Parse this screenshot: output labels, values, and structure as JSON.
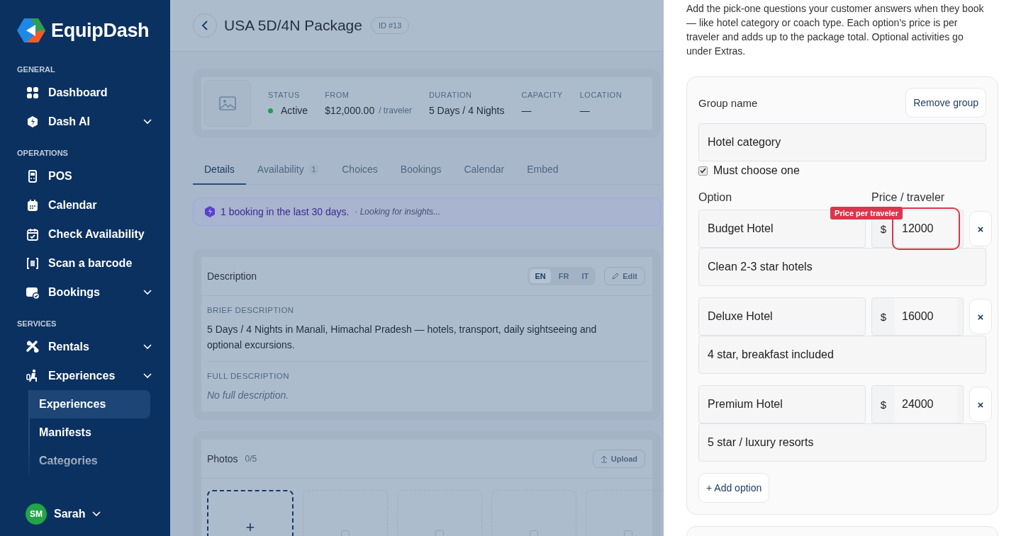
{
  "sidebar": {
    "logo": "EquipDash",
    "sections": [
      {
        "title": "GENERAL",
        "items": [
          {
            "label": "Dashboard",
            "has_menu": false
          },
          {
            "label": "Dash AI",
            "has_menu": true
          }
        ]
      },
      {
        "title": "OPERATIONS",
        "items": [
          {
            "label": "POS",
            "has_menu": false
          },
          {
            "label": "Calendar",
            "has_menu": false
          },
          {
            "label": "Check Availability",
            "has_menu": false
          },
          {
            "label": "Scan a barcode",
            "has_menu": false
          },
          {
            "label": "Bookings",
            "has_menu": true
          }
        ]
      },
      {
        "title": "SERVICES",
        "items": [
          {
            "label": "Rentals",
            "has_menu": true
          },
          {
            "label": "Experiences",
            "has_menu": true,
            "children": [
              {
                "label": "Experiences",
                "selected": true
              },
              {
                "label": "Manifests",
                "selected": false
              },
              {
                "label": "Categories",
                "selected": false
              }
            ]
          }
        ]
      }
    ],
    "user": {
      "initials": "SM",
      "name": "Sarah"
    }
  },
  "header": {
    "title": "USA 5D/4N Package",
    "id_badge": "ID #13"
  },
  "summary": [
    {
      "label": "STATUS",
      "value": "Active",
      "color": "#1f9d55"
    },
    {
      "label": "FROM",
      "value": "$12,000.00",
      "suffix": "/ traveler"
    },
    {
      "label": "DURATION",
      "value": "5 Days / 4 Nights"
    },
    {
      "label": "CAPACITY",
      "value": "—"
    },
    {
      "label": "LOCATION",
      "value": "—"
    }
  ],
  "tabs": [
    {
      "label": "Details",
      "selected": true
    },
    {
      "label": "Availability",
      "count": "1",
      "selected": false
    },
    {
      "label": "Choices",
      "selected": false
    },
    {
      "label": "Bookings",
      "selected": false
    },
    {
      "label": "Calendar",
      "selected": false
    },
    {
      "label": "Embed",
      "selected": false
    }
  ],
  "insight": {
    "text": "1 booking in the last 30 days.",
    "note": "· *Looking for insights...*"
  },
  "description": {
    "title": "Description",
    "languages": [
      {
        "label": "EN",
        "selected": true
      },
      {
        "label": "FR",
        "selected": false
      },
      {
        "label": "IT",
        "selected": false
      }
    ],
    "edit": "Edit",
    "sections": [
      {
        "label": "BRIEF DESCRIPTION",
        "text": "5 Days / 4 Nights in Manali, Himachal Pradesh — hotels, transport, daily sightseeing and optional excursions.",
        "empty": false
      },
      {
        "label": "FULL DESCRIPTION",
        "text": "No full description.",
        "empty": true
      }
    ]
  },
  "photos": {
    "title": "Photos",
    "count": "0/5",
    "upload": "Upload",
    "slots": [
      {
        "kind": "add",
        "label": "+"
      },
      {
        "kind": "empty"
      },
      {
        "kind": "empty"
      },
      {
        "kind": "empty"
      },
      {
        "kind": "empty"
      }
    ]
  },
  "panel": {
    "intro": "Add the pick-one questions your customer answers when they book — like hotel category or coach type. Each option's price is per traveler and adds up to the package total. Optional activities go under Extras.",
    "group": {
      "label": "Group name",
      "remove": "Remove group",
      "name": "Hotel category",
      "must_choose": {
        "label": "Must choose one",
        "checked": true
      },
      "option_header": "Option",
      "price_header": "Price / traveler",
      "options": [
        {
          "name": "Budget Hotel",
          "currency": "$",
          "price": "12000",
          "remove": "×",
          "description": "Clean 2-3 star hotels",
          "error": "Price per traveler"
        },
        {
          "name": "Deluxe Hotel",
          "currency": "$",
          "price": "16000",
          "remove": "×",
          "description": "4 star, breakfast included"
        },
        {
          "name": "Premium Hotel",
          "currency": "$",
          "price": "24000",
          "remove": "×",
          "description": "5 star / luxury resorts"
        }
      ],
      "add": "+ Add option"
    }
  }
}
